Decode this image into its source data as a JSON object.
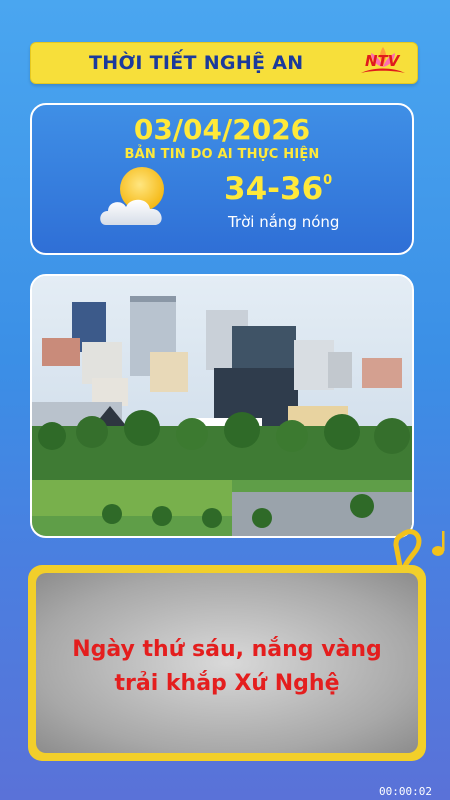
{
  "header": {
    "title": "THỜI TIẾT NGHỆ AN",
    "logo_text": "NTV"
  },
  "weather": {
    "date": "03/04/2026",
    "subtitle": "BẢN TIN DO AI THỰC HIỆN",
    "temperature": "34-36",
    "degree_symbol": "0",
    "condition": "Trời nắng nóng",
    "icon": "sun-behind-cloud-icon"
  },
  "photo": {
    "icon": "city-skyline-image"
  },
  "message": {
    "line1": "Ngày thứ sáu, nắng vàng",
    "line2": "trải khắp Xứ Nghệ"
  },
  "footer": {
    "timecode": "00:00:02"
  },
  "colors": {
    "accent_yellow": "#ffe93a",
    "banner_yellow": "#f7df3a",
    "title_blue": "#1b3a9c",
    "message_red": "#e41e1e"
  }
}
